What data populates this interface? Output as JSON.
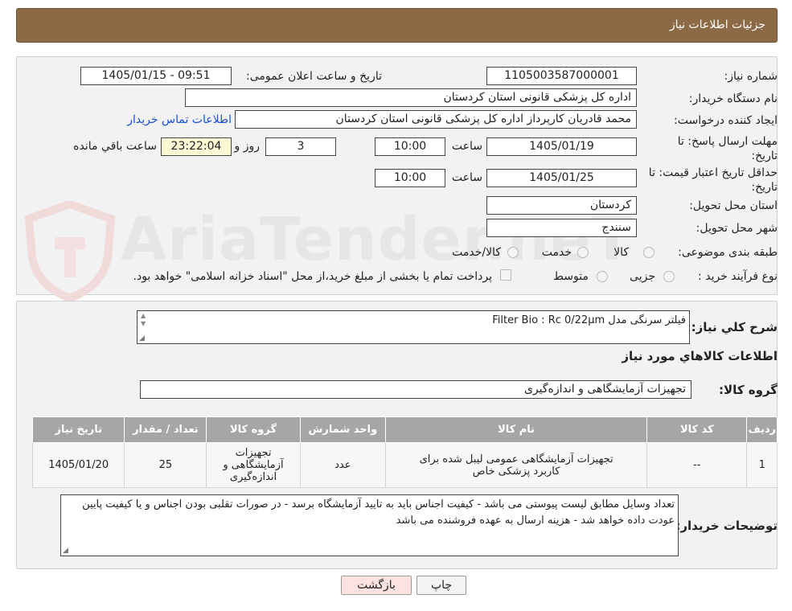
{
  "header": {
    "title": "جزئیات اطلاعات نیاز"
  },
  "watermark": {
    "text": "AriaTender.neT"
  },
  "form": {
    "need_number_label": "شماره نیاز:",
    "need_number": "1105003587000001",
    "announce_label": "تاریخ و ساعت اعلان عمومی:",
    "announce_value": "1405/01/15 - 09:51",
    "buyer_org_label": "نام دستگاه خریدار:",
    "buyer_org": "اداره کل پزشکی قانونی استان کردستان",
    "creator_label": "ایجاد کننده درخواست:",
    "creator": "محمد قادریان کارپرداز اداره کل پزشکی قانونی استان کردستان",
    "contact_link": "اطلاعات تماس خریدار",
    "deadline_label": "مهلت ارسال پاسخ: تا تاریخ:",
    "deadline_date": "1405/01/19",
    "time_label": "ساعت",
    "deadline_time": "10:00",
    "days_value": "3",
    "days_label": "روز و",
    "remaining_time": "23:22:04",
    "remaining_label": "ساعت باقي مانده",
    "validity_label": "حداقل تاریخ اعتبار قیمت: تا تاریخ:",
    "validity_date": "1405/01/25",
    "validity_time": "10:00",
    "province_label": "استان محل تحویل:",
    "province": "کردستان",
    "city_label": "شهر محل تحویل:",
    "city": "سنندج",
    "category_label": "طبقه بندی موضوعی:",
    "category_options": [
      "کالا",
      "خدمت",
      "کالا/خدمت"
    ],
    "process_label": "نوع فرآیند خرید :",
    "process_options": [
      "جزیی",
      "متوسط"
    ],
    "payment_note": "پرداخت تمام یا بخشی از مبلغ خرید،از محل \"اسناد خزانه اسلامی\" خواهد بود."
  },
  "summary": {
    "label": "شرح کلي نياز:",
    "value": "Filter Bio : Rc  0/22µm      فیلتر سرنگی مدل",
    "goods_info_title": "اطلاعات کالاهاي مورد نياز",
    "goods_group_label": "گروه کالا:",
    "goods_group": "تجهیزات آزمایشگاهی و اندازه‌گیری"
  },
  "table": {
    "headers": [
      "ردیف",
      "کد کالا",
      "نام کالا",
      "واحد شمارش",
      "گروه کالا",
      "تعداد / مقدار",
      "تاریخ نیاز"
    ],
    "rows": [
      {
        "row": "1",
        "code": "--",
        "name": "تجهیزات آزمایشگاهی عمومی لیبل شده برای کاربرد پزشکی خاص",
        "unit": "عدد",
        "group": "تجهیزات آزمایشگاهی و اندازه‌گیری",
        "qty": "25",
        "date": "1405/01/20"
      }
    ]
  },
  "buyer_notes": {
    "label": "توضیحات خریدار:",
    "value": "تعداد وسایل مطابق لیست پیوستی می باشد - کیفیت اجناس باید به تایید آزمایشگاه برسد - در صورات تقلبی بودن اجناس و یا کیفیت پایین عودت داده خواهد شد - هزینه ارسال به عهده فروشنده می باشد"
  },
  "buttons": {
    "print": "چاپ",
    "back": "بازگشت"
  },
  "colors": {
    "header_bg": "#8b6a45",
    "panel_bg": "#f2f2f2",
    "table_header": "#a6a6a6",
    "back_button": "#fde2e2",
    "link": "#1a4fd6"
  }
}
